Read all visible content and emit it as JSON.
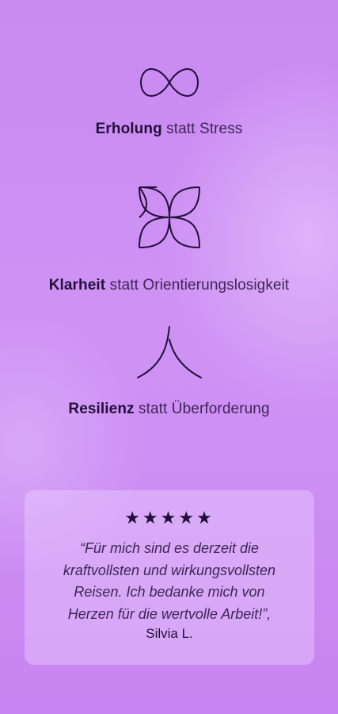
{
  "benefits": [
    {
      "icon": "infinity-icon",
      "strong": "Erholung",
      "rest": " statt Stress"
    },
    {
      "icon": "quatrefoil-icon",
      "strong": "Klarheit",
      "rest": " statt Orientierungslosigkeit"
    },
    {
      "icon": "fork-path-icon",
      "strong": "Resilienz",
      "rest": " statt Überforderung"
    }
  ],
  "review": {
    "stars": "★★★★★",
    "rating": 5,
    "quote_lines": [
      "“Für mich sind es derzeit die",
      "kraftvollsten und wirkungsvollsten",
      "Reisen. Ich bedanke mich von",
      "Herzen für die wertvolle Arbeit!”,"
    ],
    "author": "Silvia L."
  },
  "colors": {
    "background": "#cc8ef3",
    "text_dark": "#22103a",
    "text_light": "#3c2656"
  }
}
